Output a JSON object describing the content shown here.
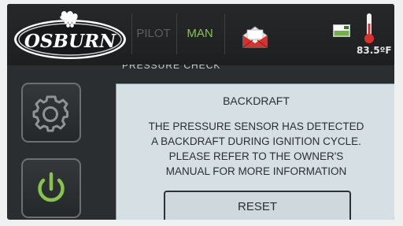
{
  "brand": {
    "logo_text": "OSBURN"
  },
  "status_bar": {
    "pilot_label": "PILOT",
    "man_label": "MAN",
    "icons": [
      "mail-alert-icon",
      "device-chip-icon",
      "thermometer-icon"
    ],
    "temperature": "83.5ºF"
  },
  "background_screen": {
    "title": "PRESSURE CHECK"
  },
  "side_buttons": {
    "icons": [
      "gear-icon",
      "power-icon"
    ]
  },
  "dialog": {
    "title": "BACKDRAFT",
    "message_lines": [
      "THE PRESSURE SENSOR HAS DETECTED",
      "A BACKDRAFT DURING IGNITION CYCLE.",
      "PLEASE REFER TO THE OWNER'S",
      "MANUAL FOR MORE INFORMATION"
    ],
    "button_label": "RESET"
  },
  "colors": {
    "screen_bg": "#2b2e31",
    "active_mode": "#86c44a",
    "inactive_mode": "#5b5f61",
    "dialog_bg": "#d5dfe4",
    "power_icon": "#86c44a",
    "alert_red": "#d9312b"
  }
}
